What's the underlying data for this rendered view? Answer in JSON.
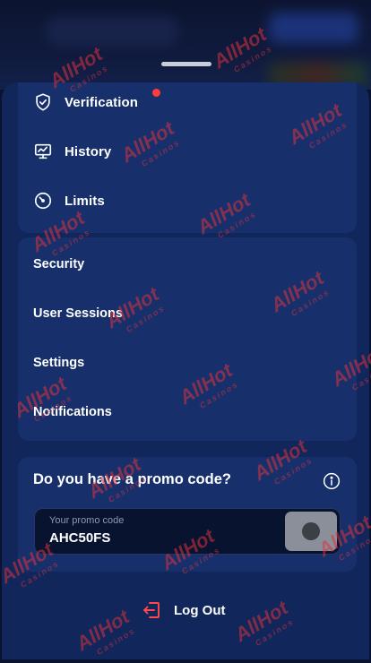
{
  "menu_primary": [
    {
      "label": "Verification",
      "icon": "shield-check-icon",
      "notification": true
    },
    {
      "label": "History",
      "icon": "monitor-chart-icon",
      "notification": false
    },
    {
      "label": "Limits",
      "icon": "gauge-icon",
      "notification": false
    }
  ],
  "menu_secondary": [
    {
      "label": "Security"
    },
    {
      "label": "User Sessions"
    },
    {
      "label": "Settings"
    },
    {
      "label": "Notifications"
    }
  ],
  "promo": {
    "title": "Do you have a promo code?",
    "info_icon": "info-circle-icon",
    "input_placeholder": "Your promo code",
    "input_value": "AHC50FS"
  },
  "logout": {
    "label": "Log Out",
    "icon": "logout-icon"
  },
  "watermark": {
    "brand": "AllHot",
    "sub": "Casinos"
  },
  "colors": {
    "background": "#0a1330",
    "sheet": "#11265a",
    "card": "#17306b",
    "input_bg": "#081330",
    "notification_dot": "#ff3b3b",
    "logout_icon": "#ff4a4a",
    "text": "#ffffff",
    "watermark": "#dc323c"
  }
}
